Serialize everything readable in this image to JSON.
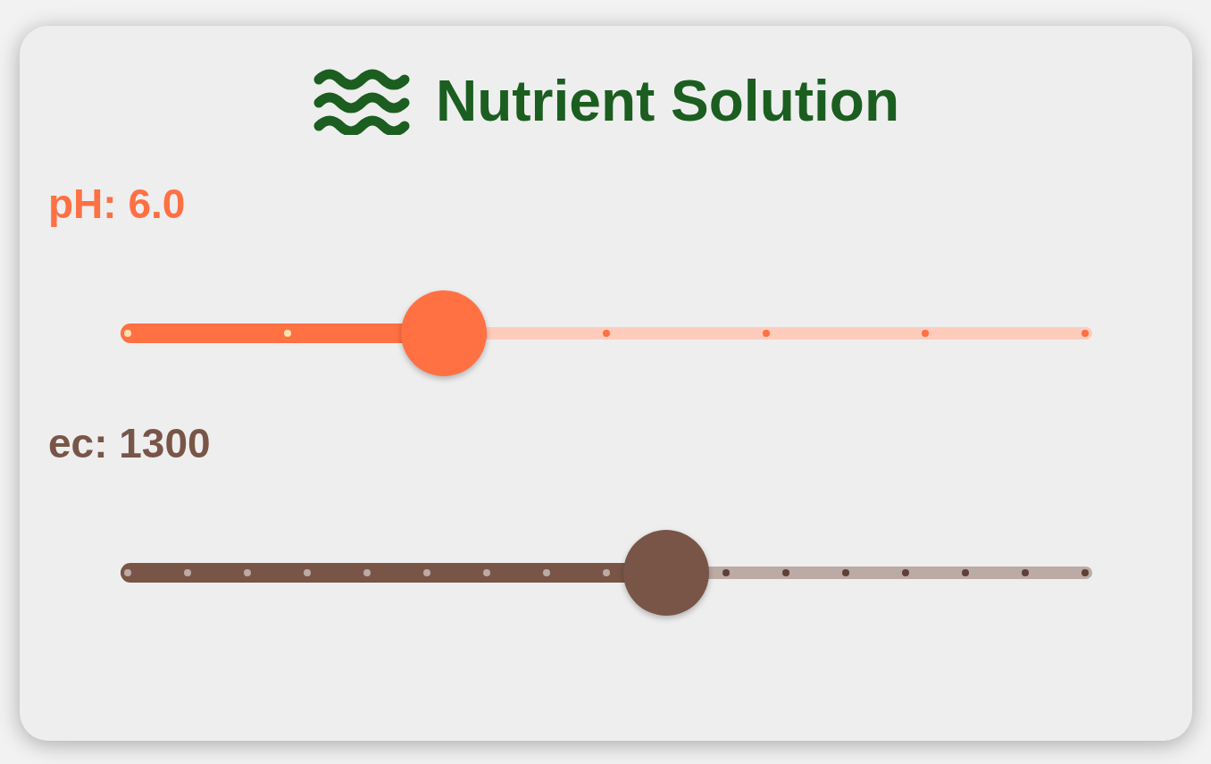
{
  "card": {
    "title": "Nutrient Solution"
  },
  "sliders": [
    {
      "kind": "ph",
      "label": "pH: 6.0",
      "color": "#ff7043",
      "level": 0.33
    },
    {
      "kind": "ec",
      "label": "ec: 1300",
      "color": "#795548",
      "level": 0.5625
    }
  ]
}
